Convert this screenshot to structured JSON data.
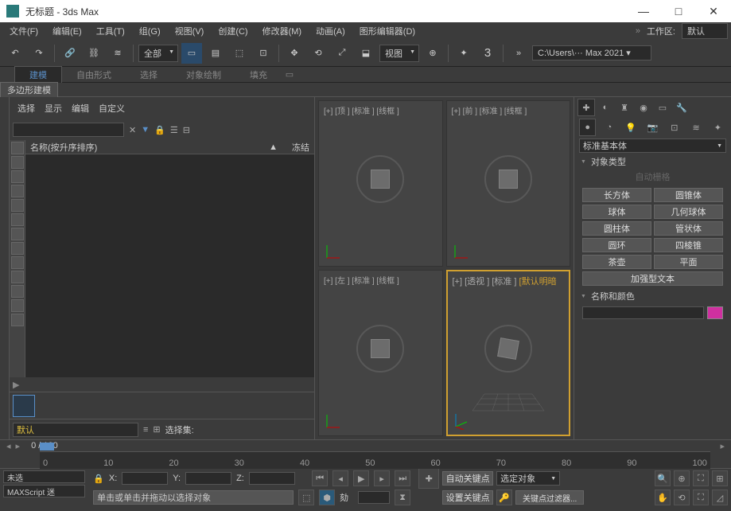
{
  "title": "无标题 - 3ds Max",
  "menu": [
    "文件(F)",
    "编辑(E)",
    "工具(T)",
    "组(G)",
    "视图(V)",
    "创建(C)",
    "修改器(M)",
    "动画(A)",
    "图形编辑器(D)"
  ],
  "workspace_label": "工作区:",
  "workspace_value": "默认",
  "toolbar": {
    "all_sel": "全部",
    "ref": "视图",
    "path": "C:\\Users\\··· Max 2021 ▾"
  },
  "ribbon": {
    "tabs": [
      "建模",
      "自由形式",
      "选择",
      "对象绘制",
      "填充"
    ],
    "subtab": "多边形建模"
  },
  "scene_explorer": {
    "tabs": [
      "选择",
      "显示",
      "编辑",
      "自定义"
    ],
    "col_name": "名称(按升序排序)",
    "col_freeze": "冻结",
    "set_value": "默认",
    "set_label": "选择集:"
  },
  "viewports": {
    "tl": "[+] [顶 ] [标准 ] [线框 ]",
    "tr": "[+] [前 ] [标准 ] [线框 ]",
    "bl": "[+] [左 ] [标准 ] [线框 ]",
    "br_a": "[+] [透视 ] [标准 ] ",
    "br_b": "[默认明暗"
  },
  "cmd": {
    "category": "标准基本体",
    "rollout_type": "对象类型",
    "autogrid": "自动栅格",
    "primitives": [
      [
        "长方体",
        "圆锥体"
      ],
      [
        "球体",
        "几何球体"
      ],
      [
        "圆柱体",
        "管状体"
      ],
      [
        "圆环",
        "四棱锥"
      ],
      [
        "茶壶",
        "平面"
      ]
    ],
    "ext_text": "加强型文本",
    "rollout_namecolor": "名称和颜色"
  },
  "timeline": {
    "frame": "0 / 100",
    "ticks": [
      "0",
      "10",
      "20",
      "30",
      "40",
      "50",
      "60",
      "70",
      "80",
      "90",
      "100"
    ]
  },
  "status": {
    "mx1": "未选",
    "mx2": "MAXScript 迷",
    "x": "X:",
    "y": "Y:",
    "z": "Z:",
    "addtime": "劾",
    "prompt": "单击或单击并拖动以选择对象",
    "autokey": "自动关键点",
    "selobj": "选定对象",
    "setkey": "设置关键点",
    "filter": "关键点过滤器..."
  }
}
